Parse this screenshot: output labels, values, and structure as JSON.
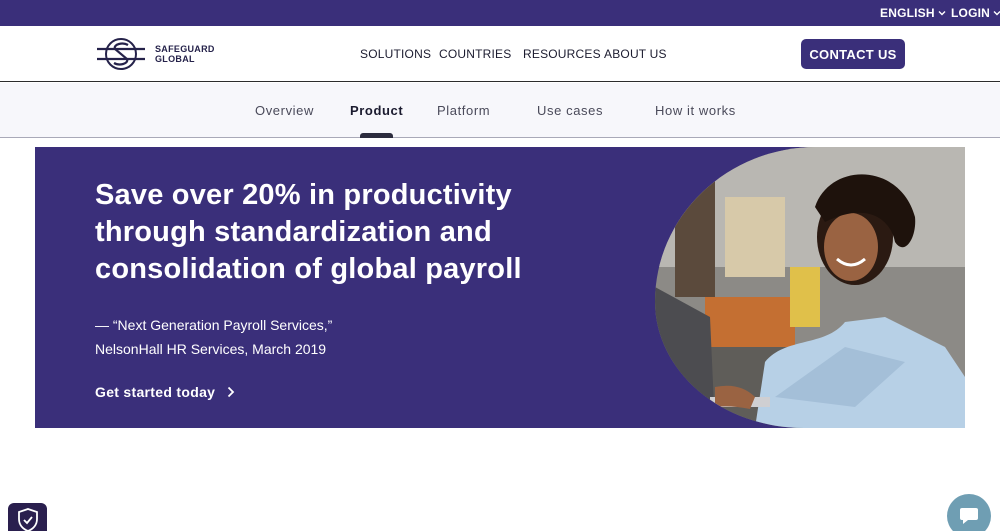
{
  "topbar": {
    "language": "ENGLISH",
    "login": "LOGIN"
  },
  "header": {
    "logo_line1": "SAFEGUARD",
    "logo_line2": "GLOBAL",
    "nav": [
      "SOLUTIONS",
      "COUNTRIES",
      "RESOURCES",
      "ABOUT US"
    ],
    "contact_label": "CONTACT US"
  },
  "subnav": {
    "items": [
      "Overview",
      "Product",
      "Platform",
      "Use cases",
      "How it works"
    ],
    "active": "Product"
  },
  "hero": {
    "title_lines": [
      "Save over 20% in productivity",
      "through standardization and",
      "consolidation of global payroll"
    ],
    "quote_lines": [
      "— “Next Generation Payroll Services,”",
      "NelsonHall HR Services, March 2019"
    ],
    "cta": "Get started today",
    "image": "woman-smiling-at-laptop-photo"
  },
  "widgets": {
    "shield_icon": "shield-check-icon",
    "chat_icon": "chat-bubble-icon"
  },
  "colors": {
    "brand_purple": "#3a2f7a",
    "chat_teal": "#6f9eb3"
  }
}
